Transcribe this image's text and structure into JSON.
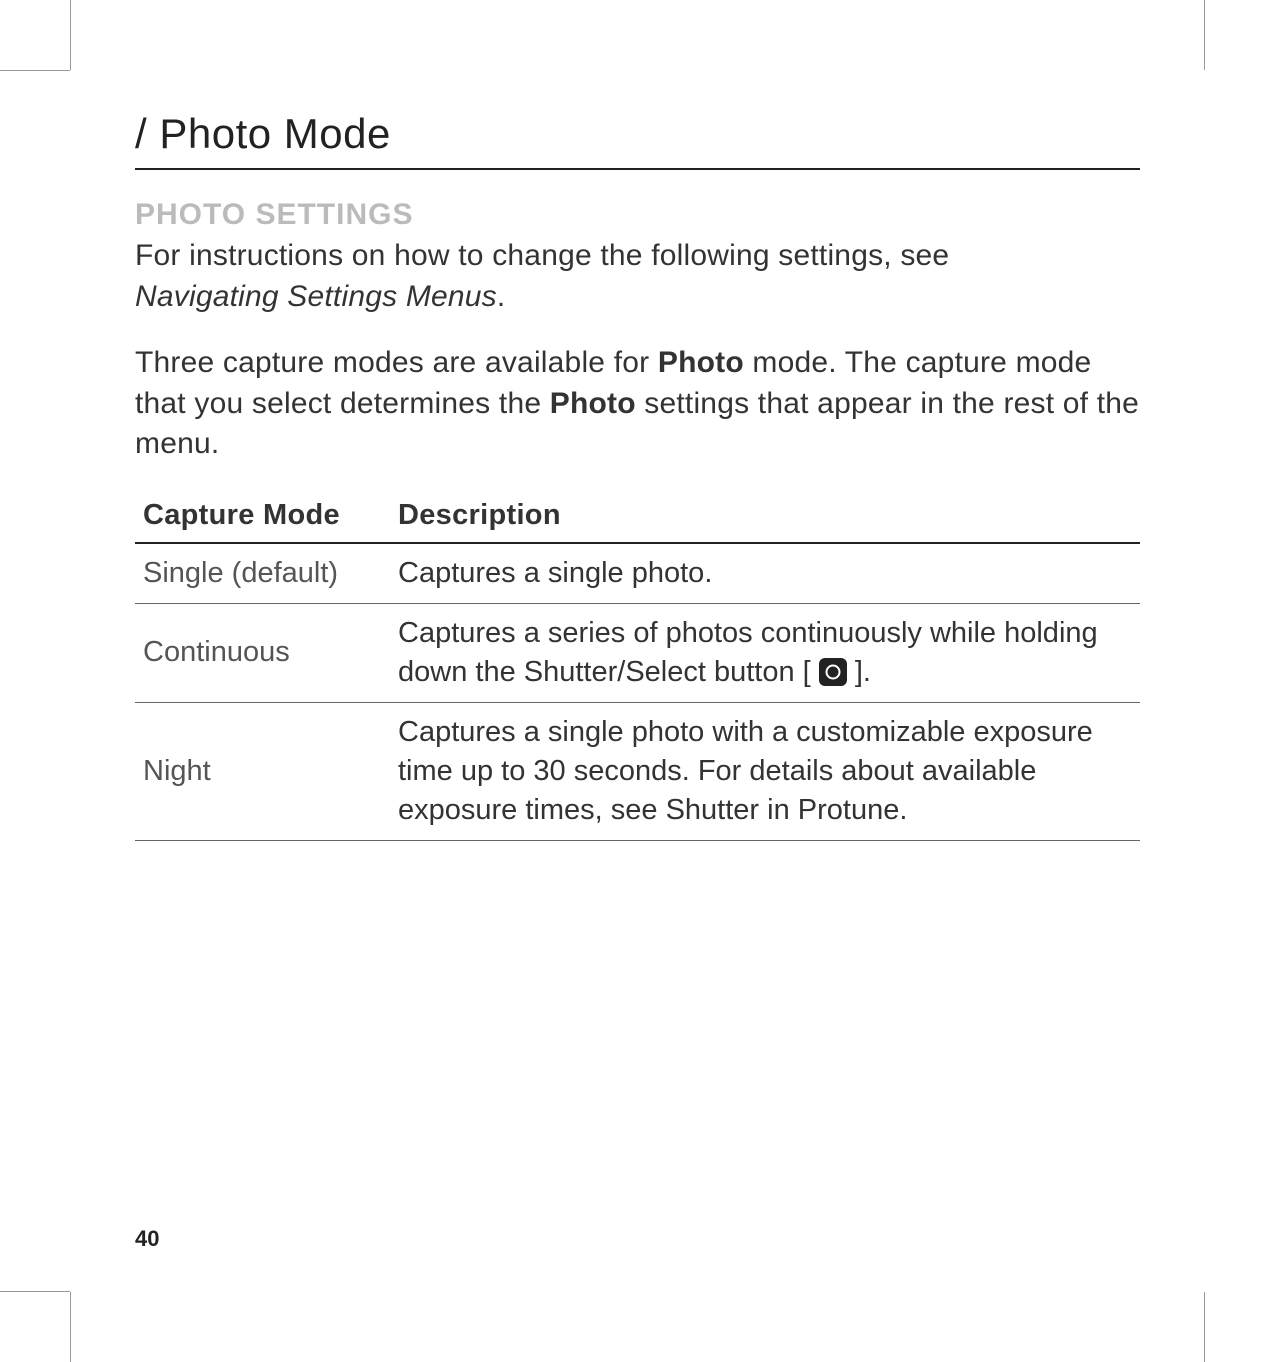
{
  "section_title": "/ Photo Mode",
  "subheading": "PHOTO SETTINGS",
  "intro_line1": "For instructions on how to change the following settings, see",
  "intro_ref": "Navigating Settings Menus",
  "intro_period": ".",
  "para2_a": "Three capture modes are available for ",
  "para2_bold1": "Photo",
  "para2_b": " mode. The capture mode that you select determines the ",
  "para2_bold2": "Photo",
  "para2_c": " settings that appear in the rest of the menu.",
  "table": {
    "header_mode": "Capture Mode",
    "header_desc": "Description",
    "rows": [
      {
        "mode": "Single (default)",
        "desc": "Captures a single photo."
      },
      {
        "mode": "Continuous",
        "desc_a": "Captures a series of photos continuously while holding down the ",
        "desc_bold": "Shutter/Select",
        "desc_b": " button [ ",
        "desc_c": " ]."
      },
      {
        "mode": "Night",
        "desc_a": "Captures a single photo with a customizable exposure time up to 30 seconds. For details about available exposure times, see ",
        "desc_italic": "Shutter",
        "desc_b": " in ",
        "desc_italic2": "Protune",
        "desc_c": "."
      }
    ]
  },
  "page_number": "40"
}
